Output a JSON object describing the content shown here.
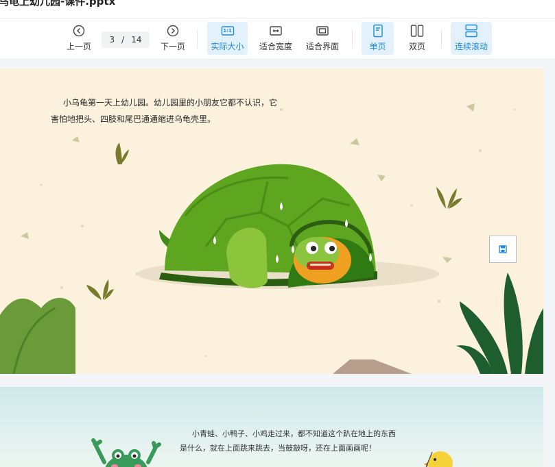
{
  "window": {
    "title": "乌龟上幼儿园-课件.pptx"
  },
  "toolbar": {
    "prev_label": "上一页",
    "next_label": "下一页",
    "current_page": "3",
    "page_sep": "/",
    "total_pages": "14",
    "actual_size_label": "实际大小",
    "actual_size_icon_text": "1:1",
    "fit_width_label": "适合宽度",
    "fit_screen_label": "适合界面",
    "single_page_label": "单页",
    "double_page_label": "双页",
    "continuous_label": "连续滚动",
    "accent_color": "#1b8ae0",
    "active_bg": "#e3f1fd"
  },
  "slides": [
    {
      "text": "小乌龟第一天上幼儿园。幼儿园里的小朋友它都不认识，它害怕地把头、四肢和尾巴通通缩进乌龟壳里。"
    },
    {
      "text": "小青蛙、小鸭子、小鸡走过来，都不知道这个趴在地上的东西是什么，就在上面跳来跳去，当鼓敲呀，还在上面画画呢！"
    }
  ],
  "icons": {
    "prev": "chevron-left-circle-icon",
    "next": "chevron-right-circle-icon",
    "fit_width": "fit-width-icon",
    "fit_screen": "fit-screen-icon",
    "single": "single-page-icon",
    "double": "double-page-icon",
    "continuous": "continuous-scroll-icon",
    "save": "save-icon"
  }
}
